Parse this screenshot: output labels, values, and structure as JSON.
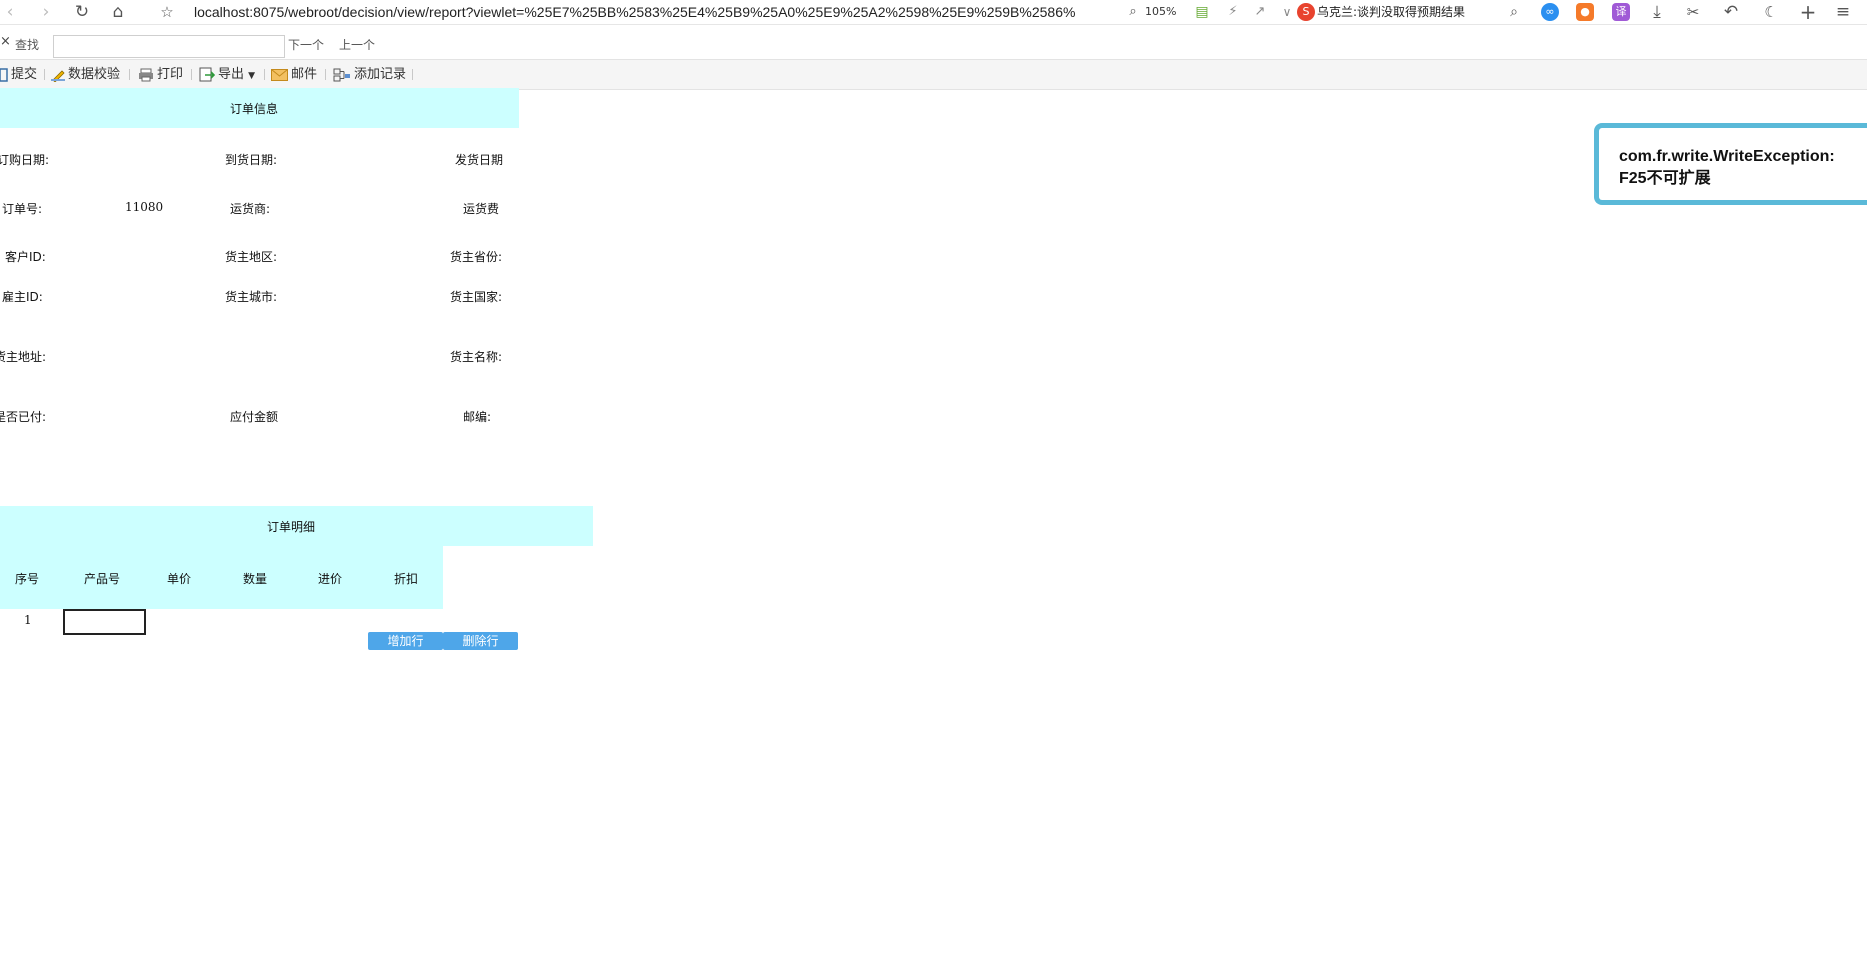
{
  "browser": {
    "url": "localhost:8075/webroot/decision/view/report?viewlet=%25E7%25BB%2583%25E4%25B9%25A0%25E9%25A2%2598%25E9%259B%2586%",
    "zoom": "105%",
    "news_ticker": "乌克兰:谈判没取得预期结果",
    "translate_label": "译"
  },
  "find_bar": {
    "close": "×",
    "label": "查找",
    "next": "下一个",
    "prev": "上一个"
  },
  "toolbar": {
    "submit": "提交",
    "validate": "数据校验",
    "print": "打印",
    "export": "导出",
    "mail": "邮件",
    "add_record": "添加记录"
  },
  "order_info": {
    "title": "订单信息",
    "order_date_label": "订购日期:",
    "arrival_date_label": "到货日期:",
    "ship_date_label": "发货日期",
    "order_no_label": "订单号:",
    "order_no_value": "11080",
    "shipper_label": "运货商:",
    "freight_label": "运货费",
    "customer_id_label": "客户ID:",
    "ship_region_label": "货主地区:",
    "ship_province_label": "货主省份:",
    "employee_id_label": "雇主ID:",
    "ship_city_label": "货主城市:",
    "ship_country_label": "货主国家:",
    "ship_address_label": "货主地址:",
    "ship_name_label": "货主名称:",
    "paid_label": "是否已付:",
    "amount_due_label": "应付金额",
    "postcode_label": "邮编:"
  },
  "order_detail": {
    "title": "订单明细",
    "columns": [
      "序号",
      "产品号",
      "单价",
      "数量",
      "进价",
      "折扣"
    ],
    "row_index": "1",
    "add_row": "增加行",
    "delete_row": "删除行"
  },
  "error": {
    "message": "com.fr.write.WriteException: F25不可扩展"
  }
}
